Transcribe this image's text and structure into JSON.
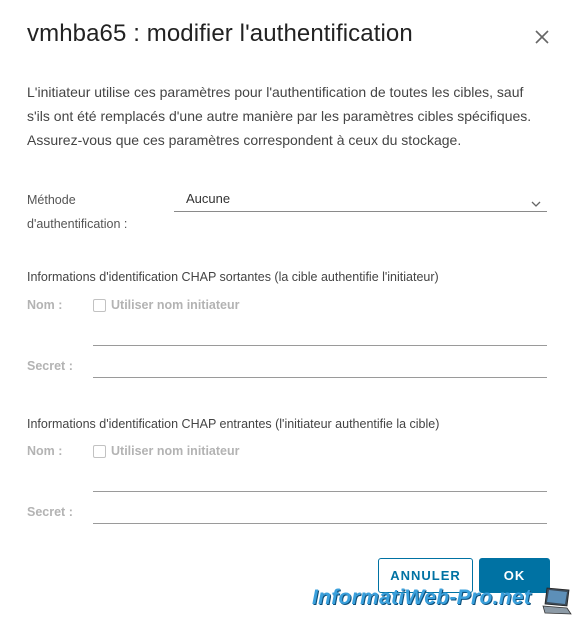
{
  "dialog": {
    "title": "vmhba65 : modifier l'authentification",
    "description": "L'initiateur utilise ces paramètres pour l'authentification de toutes les cibles, sauf s'ils ont été remplacés d'une autre manière par les paramètres cibles spécifiques. Assurez-vous que ces paramètres correspondent à ceux du stockage."
  },
  "auth_method": {
    "label_line1": "Méthode",
    "label_line2": "d'authentification :",
    "value": "Aucune"
  },
  "outgoing": {
    "heading": "Informations d'identification CHAP sortantes (la cible authentifie l'initiateur)",
    "name_label": "Nom :",
    "checkbox_label": "Utiliser nom initiateur",
    "secret_label": "Secret :"
  },
  "incoming": {
    "heading": "Informations d'identification CHAP entrantes (l'initiateur authentifie la cible)",
    "name_label": "Nom :",
    "checkbox_label": "Utiliser nom initiateur",
    "secret_label": "Secret :"
  },
  "footer": {
    "cancel_label": "ANNULER",
    "ok_label": "OK"
  },
  "watermark": {
    "text": "InformatiWeb-Pro.net"
  },
  "colors": {
    "primary": "#0072a3",
    "disabled_text": "#b3b3b3"
  }
}
